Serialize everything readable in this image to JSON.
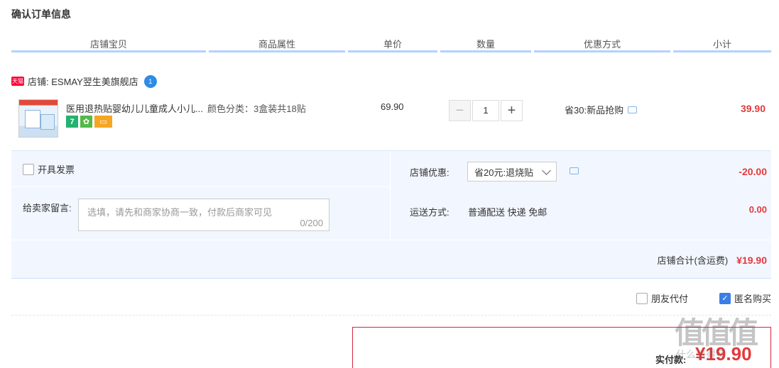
{
  "section_title": "确认订单信息",
  "columns": [
    "店铺宝贝",
    "商品属性",
    "单价",
    "数量",
    "优惠方式",
    "小计"
  ],
  "shop": {
    "badge": "天猫",
    "name": "店铺: ESMAY翌生美旗舰店",
    "ww_icon_text": "1"
  },
  "item": {
    "title": "医用退热贴婴幼儿儿童成人小儿...",
    "attr": "颜色分类：3盒装共18贴",
    "price": "69.90",
    "quantity": "1",
    "qty_minus": "−",
    "qty_plus": "+",
    "promo": "省30:新品抢购",
    "subtotal": "39.90",
    "svc_seven": "7"
  },
  "extras": {
    "invoice_label": "开具发票",
    "message_label": "给卖家留言:",
    "message_placeholder": "选填，请先和商家协商一致，付款后商家可见",
    "message_count": "0/200",
    "shop_discount_label": "店铺优惠:",
    "shop_discount_selected": "省20元:退烧贴",
    "shop_discount_value": "-20.00",
    "shipping_label": "运送方式:",
    "shipping_value": "普通配送 快递 免邮",
    "shipping_fee": "0.00",
    "shop_total_label": "店铺合计(含运费)",
    "shop_total_value": "¥19.90"
  },
  "options": {
    "friend_pay": "朋友代付",
    "anonymous": "匿名购买"
  },
  "payment": {
    "label": "实付款:",
    "amount": "¥19.90"
  },
  "watermark": {
    "big": "值值值",
    "small": "什么值得买"
  },
  "colors": {
    "accent_red": "#e4393c",
    "header_line": "#b2d1ff",
    "panel_bg": "#f2f7ff",
    "checkbox_blue": "#3a7ee8"
  }
}
